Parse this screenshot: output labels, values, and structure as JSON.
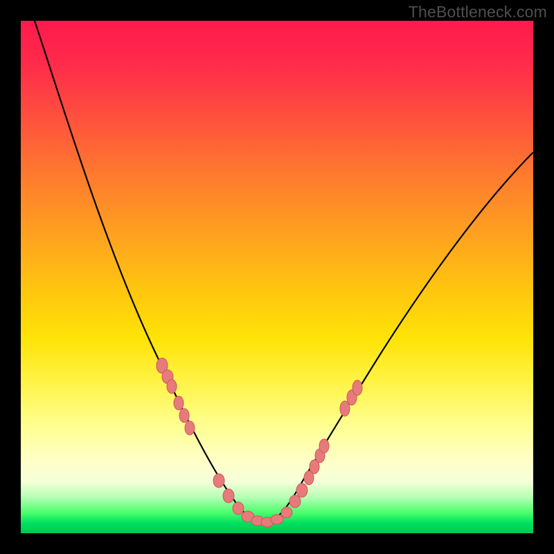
{
  "watermark": "TheBottleneck.com",
  "colors": {
    "curve": "#000000",
    "marker_fill": "#e77a7a",
    "marker_stroke": "#c95a5a",
    "gradient_top": "#ff1a4d",
    "gradient_bottom": "#00c851",
    "frame": "#000000"
  },
  "chart_data": {
    "type": "line",
    "title": "",
    "xlabel": "",
    "ylabel": "",
    "xlim": [
      0,
      100
    ],
    "ylim": [
      0,
      100
    ],
    "grid": false,
    "legend": false,
    "series": [
      {
        "name": "bottleneck-curve",
        "x": [
          0,
          5,
          10,
          15,
          20,
          25,
          30,
          33,
          36,
          39,
          41,
          43,
          45,
          47,
          50,
          55,
          60,
          65,
          70,
          75,
          80,
          85,
          90,
          95,
          100
        ],
        "values": [
          100,
          90,
          79,
          67,
          55,
          43,
          31,
          24,
          17,
          10,
          6,
          3,
          1,
          1,
          3,
          8,
          14,
          20,
          27,
          34,
          41,
          48,
          55,
          62,
          69
        ]
      }
    ],
    "markers": {
      "name": "highlighted-points",
      "x": [
        25,
        26,
        27,
        29,
        30,
        31,
        37,
        39,
        41,
        43,
        45,
        46,
        48,
        50,
        51,
        53,
        54,
        55,
        56,
        57
      ],
      "values": [
        43,
        41,
        39,
        33,
        31,
        29,
        14,
        10,
        6,
        3,
        1,
        1,
        1,
        3,
        4,
        7,
        8,
        10,
        11,
        12,
        28,
        30,
        32
      ]
    }
  }
}
